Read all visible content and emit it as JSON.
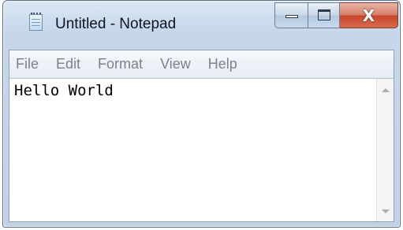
{
  "window": {
    "title": "Untitled - Notepad",
    "close_glyph": "X"
  },
  "menu": {
    "items": [
      {
        "label": "File"
      },
      {
        "label": "Edit"
      },
      {
        "label": "Format"
      },
      {
        "label": "View"
      },
      {
        "label": "Help"
      }
    ]
  },
  "editor": {
    "text": "Hello World"
  },
  "icons": {
    "app": "notepad-icon",
    "minimize": "minimize-icon",
    "maximize": "maximize-icon",
    "close": "close-icon",
    "scroll_up": "scroll-up-arrow-icon",
    "scroll_down": "scroll-down-arrow-icon"
  },
  "colors": {
    "title_bar": "#c6d7ea",
    "close_button": "#c7452b",
    "menu_text": "#7b828c"
  }
}
